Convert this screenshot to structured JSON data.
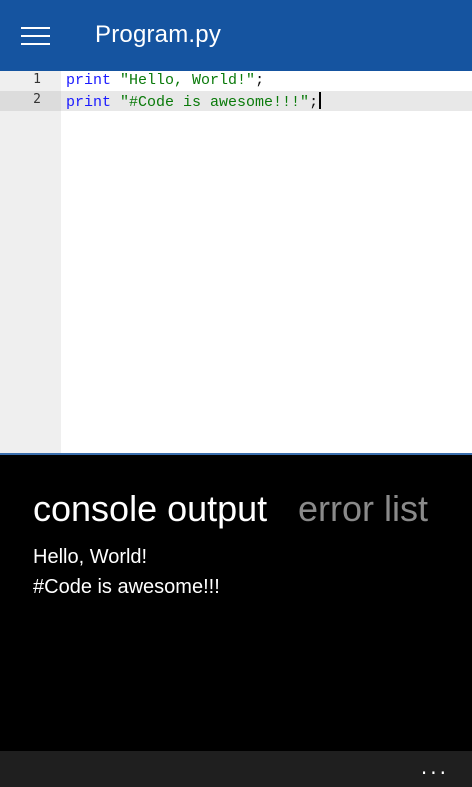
{
  "header": {
    "title": "Program.py",
    "menu_icon": "hamburger-menu-icon",
    "background": "#1554a0"
  },
  "editor": {
    "lines": [
      {
        "number": "1",
        "keyword": "print",
        "string": "\"Hello, World!\"",
        "terminator": ";"
      },
      {
        "number": "2",
        "keyword": "print",
        "string": "\"#Code is awesome!!!\"",
        "terminator": ";"
      }
    ],
    "current_line": 2,
    "colors": {
      "keyword": "#1a1aff",
      "string": "#0a7a0a"
    }
  },
  "console": {
    "tabs": [
      {
        "label": "console output",
        "active": true
      },
      {
        "label": "error list",
        "active": false
      }
    ],
    "output": [
      "Hello, World!",
      "#Code is awesome!!!"
    ]
  },
  "appbar": {
    "more_label": "...",
    "more_icon": "ellipsis-icon"
  }
}
